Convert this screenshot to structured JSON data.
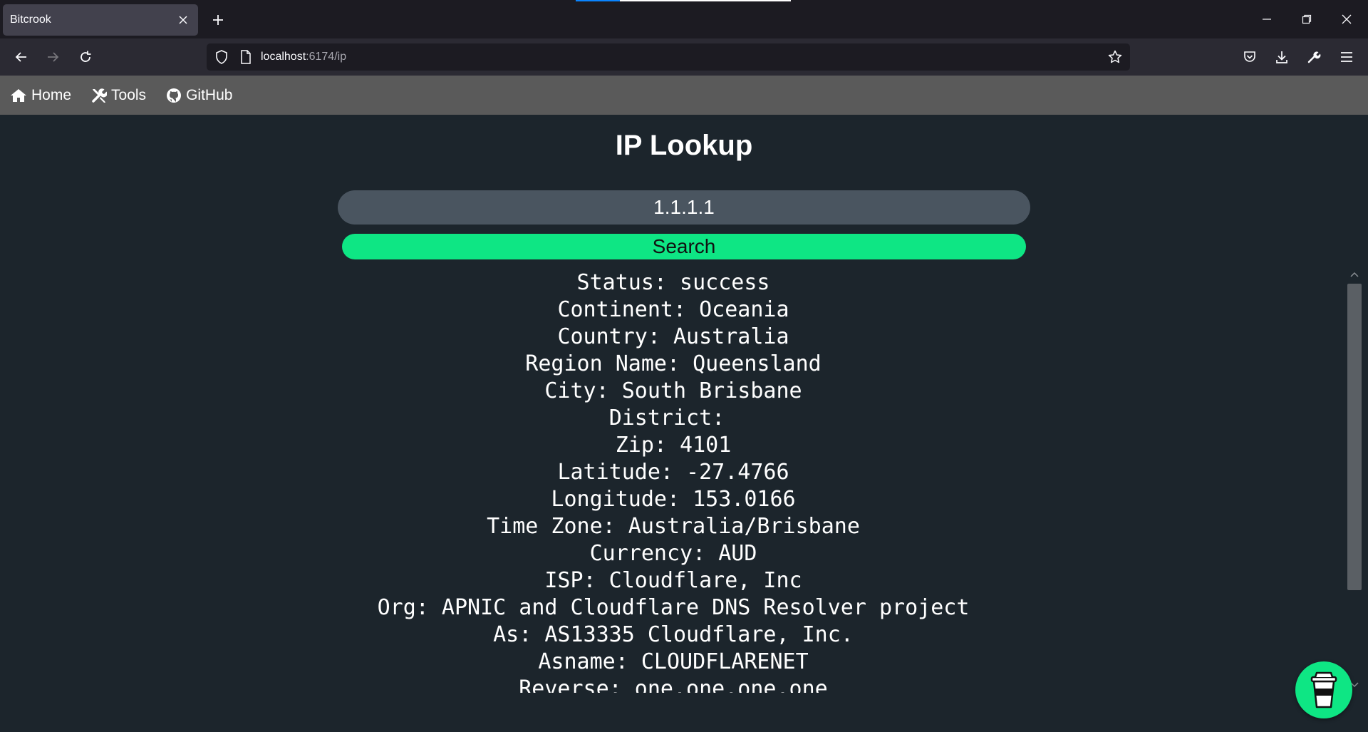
{
  "browser": {
    "tab_title": "Bitcrook",
    "url_host": "localhost",
    "url_rest": ":6174/ip"
  },
  "sitenav": {
    "items": [
      {
        "label": "Home",
        "icon": "home-icon"
      },
      {
        "label": "Tools",
        "icon": "tools-icon"
      },
      {
        "label": "GitHub",
        "icon": "github-icon"
      }
    ]
  },
  "main": {
    "title": "IP Lookup",
    "ip_value": "1.1.1.1",
    "search_label": "Search",
    "results": [
      "Status: success",
      "Continent: Oceania",
      "Country: Australia",
      "Region Name: Queensland",
      "City: South Brisbane",
      "District: ",
      "Zip: 4101",
      "Latitude: -27.4766",
      "Longitude: 153.0166",
      "Time Zone: Australia/Brisbane",
      "Currency: AUD",
      "ISP: Cloudflare, Inc",
      "Org: APNIC and Cloudflare DNS Resolver project",
      "As: AS13335 Cloudflare, Inc.",
      "Asname: CLOUDFLARENET",
      "Reverse: one.one.one.one"
    ]
  },
  "colors": {
    "page_bg": "#1c252c",
    "nav_bg": "#5a5a5a",
    "accent": "#0ee684",
    "input_bg": "#4a5560"
  }
}
